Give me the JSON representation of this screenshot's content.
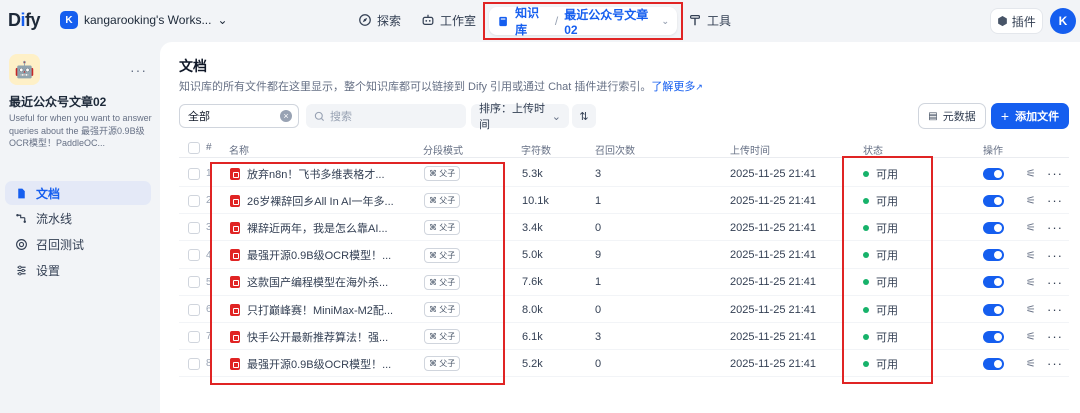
{
  "topbar": {
    "logo": "Dify",
    "workspace_initial": "K",
    "workspace_name": "kangarooking's Works...",
    "nav": {
      "explore": "探索",
      "studio": "工作室",
      "knowledge": "知识库",
      "knowledge_current": "最近公众号文章02",
      "tools": "工具"
    },
    "plugins": "插件",
    "user_initial": "K"
  },
  "sidebar": {
    "dataset_name": "最近公众号文章02",
    "dataset_desc": "Useful for when you want to answer queries about the 最强开源0.9B级OCR模型！PaddleOC...",
    "items": [
      {
        "label": "文档",
        "icon": "file-icon",
        "active": true
      },
      {
        "label": "流水线",
        "icon": "pipeline-icon",
        "active": false
      },
      {
        "label": "召回测试",
        "icon": "target-icon",
        "active": false
      },
      {
        "label": "设置",
        "icon": "settings-icon",
        "active": false
      }
    ]
  },
  "main": {
    "title": "文档",
    "subtitle": "知识库的所有文件都在这里显示，整个知识库都可以链接到 Dify 引用或通过 Chat 插件进行索引。",
    "learn_more": "了解更多",
    "filter_value": "全部",
    "search_placeholder": "搜索",
    "sort_label": "排序：上传时间",
    "metadata_button": "元数据",
    "add_button": "添加文件",
    "columns": {
      "index": "#",
      "name": "名称",
      "mode": "分段模式",
      "chars": "字符数",
      "hits": "召回次数",
      "uploaded": "上传时间",
      "status": "状态",
      "actions": "操作"
    },
    "rows": [
      {
        "index": "1",
        "name": "放弃n8n！飞书多维表格才...",
        "mode": "父子",
        "chars": "5.3k",
        "hits": "3",
        "time": "2025-11-25 21:41",
        "status": "可用"
      },
      {
        "index": "2",
        "name": "26岁裸辞回乡All In AI一年多...",
        "mode": "父子",
        "chars": "10.1k",
        "hits": "1",
        "time": "2025-11-25 21:41",
        "status": "可用"
      },
      {
        "index": "3",
        "name": "裸辞近两年，我是怎么靠AI...",
        "mode": "父子",
        "chars": "3.4k",
        "hits": "0",
        "time": "2025-11-25 21:41",
        "status": "可用"
      },
      {
        "index": "4",
        "name": "最强开源0.9B级OCR模型！...",
        "mode": "父子",
        "chars": "5.0k",
        "hits": "9",
        "time": "2025-11-25 21:41",
        "status": "可用"
      },
      {
        "index": "5",
        "name": "这款国产编程模型在海外杀...",
        "mode": "父子",
        "chars": "7.6k",
        "hits": "1",
        "time": "2025-11-25 21:41",
        "status": "可用"
      },
      {
        "index": "6",
        "name": "只打巅峰赛！MiniMax-M2配...",
        "mode": "父子",
        "chars": "8.0k",
        "hits": "0",
        "time": "2025-11-25 21:41",
        "status": "可用"
      },
      {
        "index": "7",
        "name": "快手公开最新推荐算法！强...",
        "mode": "父子",
        "chars": "6.1k",
        "hits": "3",
        "time": "2025-11-25 21:41",
        "status": "可用"
      },
      {
        "index": "8",
        "name": "最强开源0.9B级OCR模型！...",
        "mode": "父子",
        "chars": "5.2k",
        "hits": "0",
        "time": "2025-11-25 21:41",
        "status": "可用"
      }
    ]
  }
}
